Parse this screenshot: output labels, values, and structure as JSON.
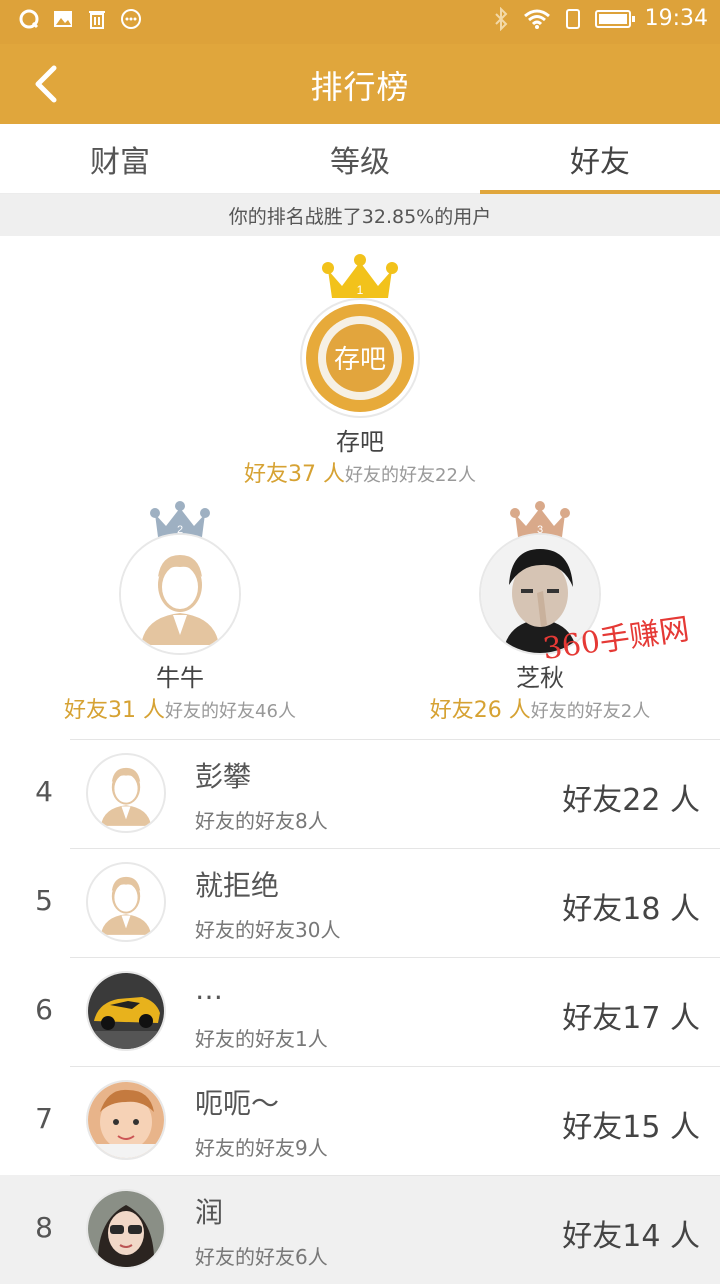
{
  "status_bar": {
    "time": "19:34",
    "left_icons": [
      "qq-icon",
      "image-icon",
      "trash-icon",
      "more-icon"
    ],
    "right_icons": [
      "bluetooth-icon",
      "wifi-icon",
      "sim-icon",
      "battery-icon"
    ]
  },
  "header": {
    "title": "排行榜",
    "back_icon": "chevron-left-icon"
  },
  "tabs": [
    {
      "label": "财富",
      "active": false
    },
    {
      "label": "等级",
      "active": false
    },
    {
      "label": "好友",
      "active": true
    }
  ],
  "banner": {
    "text": "你的排名战胜了32.85%的用户"
  },
  "podium": [
    {
      "rank": "1",
      "name": "存吧",
      "friends": "好友37 人",
      "fof": "好友的好友22人",
      "avatar_text": "存吧",
      "crown_color": "#f2c21b"
    },
    {
      "rank": "2",
      "name": "牛牛",
      "friends": "好友31 人",
      "fof": "好友的好友46人",
      "crown_color": "#9eb0c2"
    },
    {
      "rank": "3",
      "name": "芝秋",
      "friends": "好友26 人",
      "fof": "好友的好友2人",
      "crown_color": "#d9a98a"
    }
  ],
  "watermark": "360手赚网",
  "list": [
    {
      "rank": "4",
      "name": "彭攀",
      "fof": "好友的好友8人",
      "friends": "好友22 人",
      "avatar": "default"
    },
    {
      "rank": "5",
      "name": "就拒绝",
      "fof": "好友的好友30人",
      "friends": "好友18 人",
      "avatar": "default"
    },
    {
      "rank": "6",
      "name": "…",
      "fof": "好友的好友1人",
      "friends": "好友17 人",
      "avatar": "car"
    },
    {
      "rank": "7",
      "name": "呃呃～",
      "fof": "好友的好友9人",
      "friends": "好友15 人",
      "avatar": "baby"
    },
    {
      "rank": "8",
      "name": "润",
      "fof": "好友的好友6人",
      "friends": "好友14 人",
      "avatar": "woman"
    }
  ],
  "colors": {
    "brand": "#e0a63c",
    "gold_text": "#d6a233"
  }
}
